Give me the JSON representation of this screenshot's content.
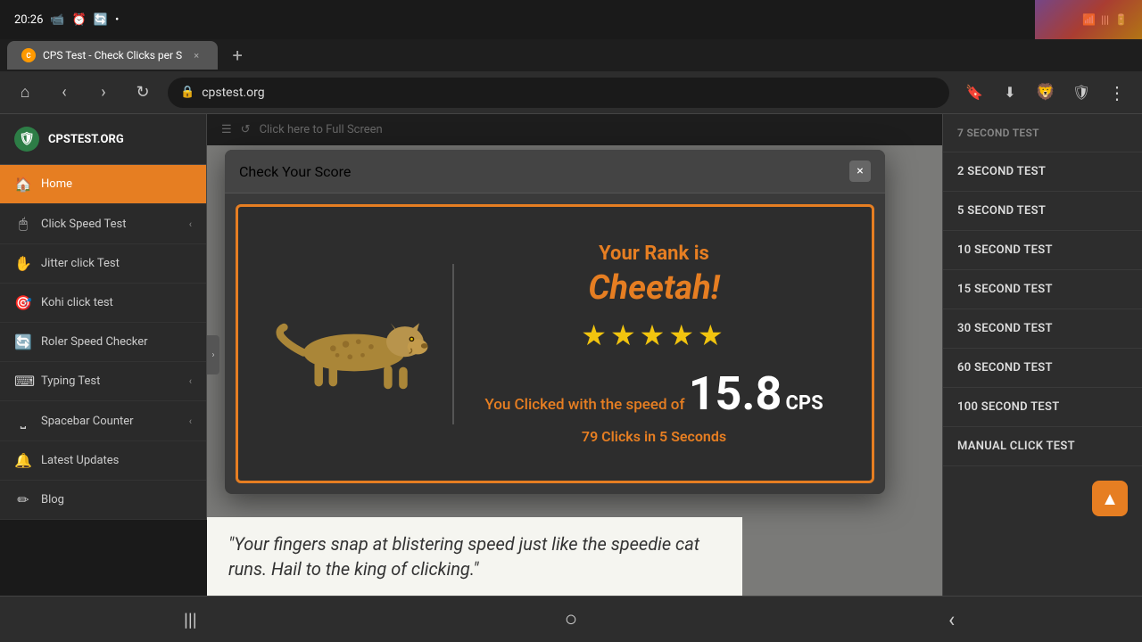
{
  "statusBar": {
    "time": "20:26",
    "icons": [
      "video",
      "alarm",
      "sync",
      "notification"
    ]
  },
  "browser": {
    "tab": {
      "favicon": "C",
      "title": "CPS Test - Check Clicks per S",
      "closeLabel": "×"
    },
    "newTabLabel": "+",
    "addressBar": {
      "url": "cpstest.org",
      "lockIcon": "🔒"
    },
    "navButtons": {
      "back": "‹",
      "forward": "›",
      "home": "⌂",
      "refresh": "↻"
    },
    "actions": {
      "bookmark": "🔖",
      "download": "⬇",
      "brave": "🦁",
      "shield": "🛡",
      "menu": "⋮"
    }
  },
  "fullscreenBar": {
    "menuIcon": "☰",
    "refreshIcon": "↺",
    "text": "Click here to Full Screen"
  },
  "sidebar": {
    "logo": {
      "icon": "🛡",
      "text": "CPSTEST.ORG"
    },
    "items": [
      {
        "icon": "🏠",
        "label": "Home",
        "active": true
      },
      {
        "icon": "🖱",
        "label": "Click Speed Test",
        "chevron": "‹"
      },
      {
        "icon": "✋",
        "label": "Jitter click Test"
      },
      {
        "icon": "🎯",
        "label": "Kohi click test"
      },
      {
        "icon": "🔄",
        "label": "Roler Speed Checker"
      },
      {
        "icon": "⌨",
        "label": "Typing Test",
        "chevron": "‹"
      },
      {
        "icon": "⎵",
        "label": "Spacebar Counter",
        "chevron": "‹"
      },
      {
        "icon": "🔔",
        "label": "Latest Updates"
      },
      {
        "icon": "✏",
        "label": "Blog"
      }
    ]
  },
  "dialog": {
    "title": "Check Your Score",
    "closeLabel": "×",
    "rankLabel": "Your Rank is",
    "rankName": "Cheetah!",
    "stars": "★★★★★",
    "speedPrefix": "You Clicked with the speed of",
    "speedValue": "15.8",
    "speedUnit": "CPS",
    "clicksInfo": "79 Clicks in 5 Seconds"
  },
  "quote": "\"Your fingers snap at blistering speed just like the speedie cat runs. Hail to the king of clicking.\"",
  "rightSidebar": {
    "items": [
      {
        "label": "7 SECOND TEST",
        "partial": true
      },
      {
        "label": "2 SECOND TEST"
      },
      {
        "label": "5 SECOND TEST"
      },
      {
        "label": "10 SECOND TEST"
      },
      {
        "label": "15 SECOND TEST"
      },
      {
        "label": "30 SECOND TEST"
      },
      {
        "label": "60 SECOND TEST"
      },
      {
        "label": "100 SECOND TEST"
      },
      {
        "label": "MANUAL CLICK TEST"
      }
    ]
  },
  "scrollTopBtn": "▲",
  "bottomNav": {
    "menu": "|||",
    "home": "○",
    "back": "‹"
  }
}
